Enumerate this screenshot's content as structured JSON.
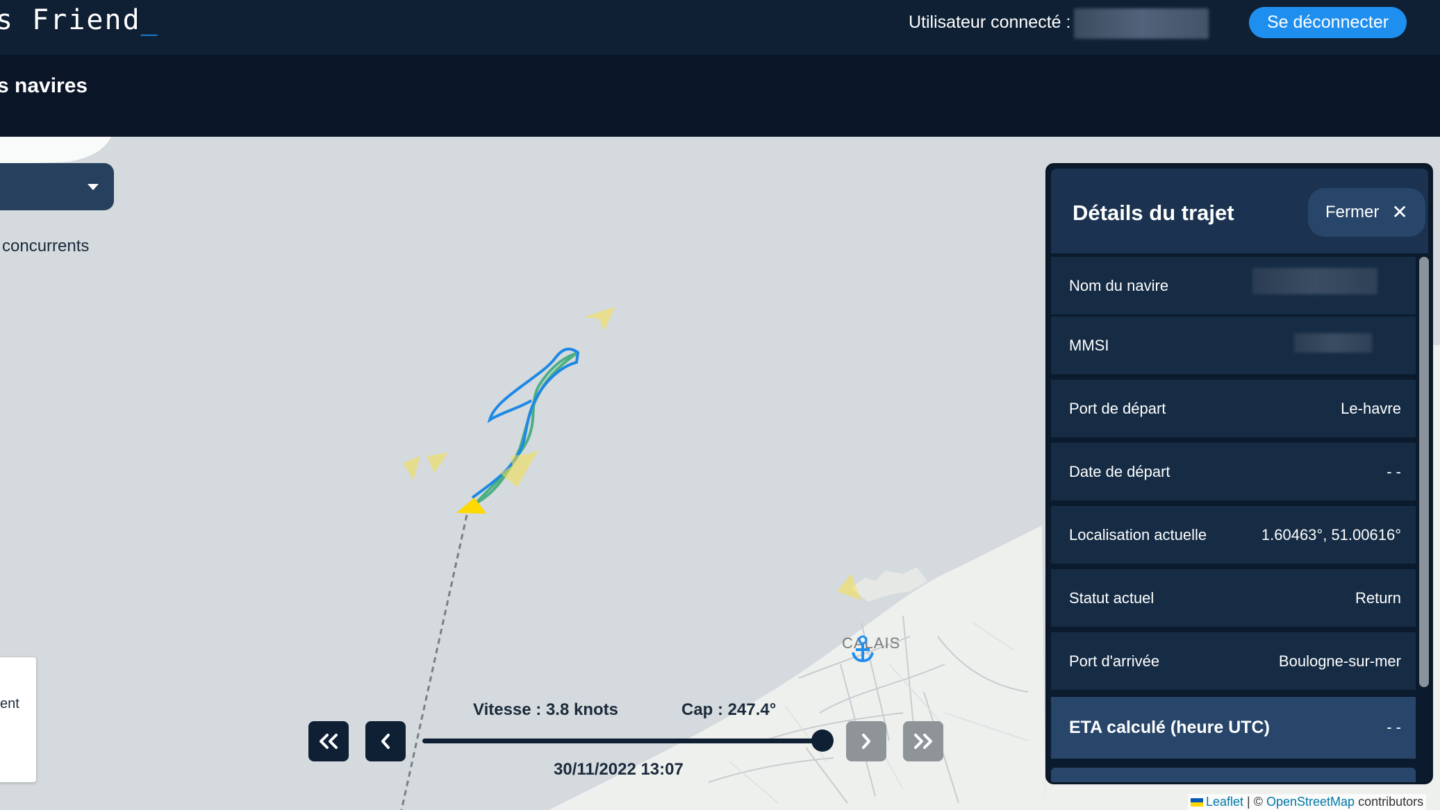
{
  "app": {
    "brand": "s Friend",
    "brand_cursor": "_",
    "user_label": "Utilisateur connecté :",
    "logout_label": "Se déconnecter"
  },
  "page": {
    "title": "s navires"
  },
  "map": {
    "competitors_label": "concurrents",
    "legend_text": "ent",
    "city_label": "CALAIS",
    "attribution": {
      "leaflet": "Leaflet",
      "separator": " | © ",
      "osm": "OpenStreetMap",
      "suffix": " contributors"
    }
  },
  "playback": {
    "speed": "Vitesse : 3.8 knots",
    "heading": "Cap : 247.4°",
    "datetime": "30/11/2022 13:07",
    "progress": 0.98,
    "icons": [
      "double-chevron-left-icon",
      "chevron-left-icon",
      "chevron-right-icon",
      "double-chevron-right-icon"
    ]
  },
  "details": {
    "title": "Détails du trajet",
    "close_label": "Fermer",
    "rows": [
      {
        "label": "Nom du navire",
        "value": ""
      },
      {
        "label": "MMSI",
        "value": ""
      },
      {
        "label": "Port de départ",
        "value": "Le-havre"
      },
      {
        "label": "Date de départ",
        "value": "- -"
      },
      {
        "label": "Localisation actuelle",
        "value": "1.60463°, 51.00616°"
      },
      {
        "label": "Statut actuel",
        "value": "Return"
      },
      {
        "label": "Port d'arrivée",
        "value": "Boulogne-sur-mer"
      }
    ],
    "eta": {
      "label": "ETA calculé (heure UTC)",
      "value": "- -"
    }
  },
  "colors": {
    "topbar": "#0f2034",
    "accent": "#1f8fef",
    "panel": "#162c45",
    "track_blue": "#1e88e5",
    "track_green": "#4caf82",
    "vessel_yellow": "#f5e04a"
  }
}
